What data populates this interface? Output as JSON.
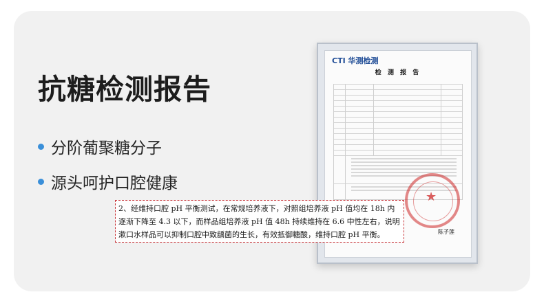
{
  "title": "抗糖检测报告",
  "bullets": [
    "分阶葡聚糖分子",
    "源头呵护口腔健康"
  ],
  "report": {
    "logo": "CTI 华测检测",
    "heading": "检 测 报 告",
    "signature": "陈子莲"
  },
  "note": "2、经维持口腔 pH 平衡测试，在常规培养液下，对照组培养液 pH 值均在 18h 内逐渐下降至 4.3 以下，而样品组培养液 pH 值 48h 持续维持在 6.6 中性左右，说明漱口水样品可以抑制口腔中致龋菌的生长，有效抵御糖酸，维持口腔 pH 平衡。",
  "colors": {
    "card": "#f1f1f1",
    "accent": "#3a8fd9",
    "note_border": "#c8353a",
    "logo": "#1f4c96"
  }
}
